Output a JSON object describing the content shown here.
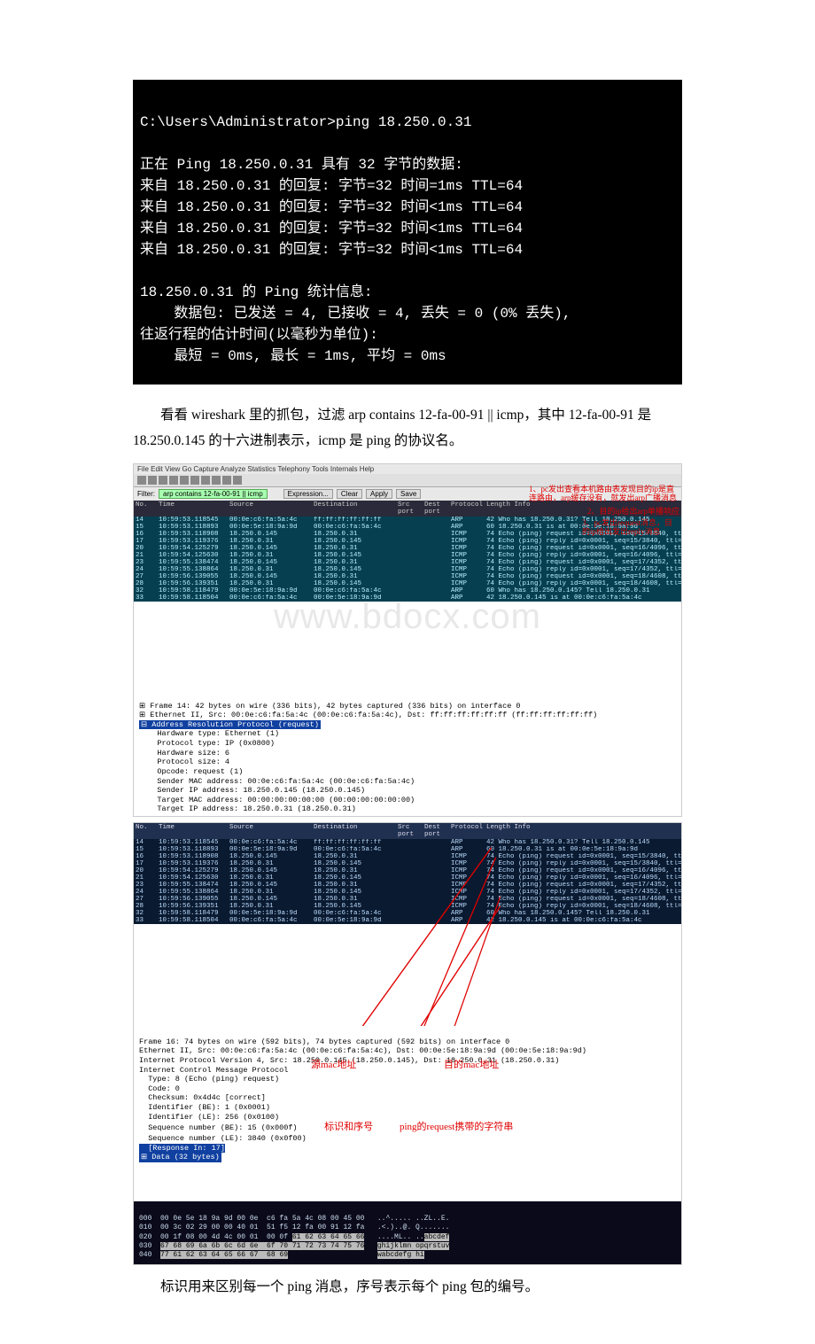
{
  "terminal": {
    "prompt": "C:\\Users\\Administrator>ping 18.250.0.31",
    "l1": "正在 Ping 18.250.0.31 具有 32 字节的数据:",
    "l2": "来自 18.250.0.31 的回复: 字节=32 时间=1ms TTL=64",
    "l3": "来自 18.250.0.31 的回复: 字节=32 时间<1ms TTL=64",
    "l4": "来自 18.250.0.31 的回复: 字节=32 时间<1ms TTL=64",
    "l5": "来自 18.250.0.31 的回复: 字节=32 时间<1ms TTL=64",
    "s1": "18.250.0.31 的 Ping 统计信息:",
    "s2": "    数据包: 已发送 = 4, 已接收 = 4, 丢失 = 0 (0% 丢失),",
    "s3": "往返行程的估计时间(以毫秒为单位):",
    "s4": "    最短 = 0ms, 最长 = 1ms, 平均 = 0ms"
  },
  "para1": "看看 wireshark 里的抓包，过滤 arp contains 12-fa-00-91 || icmp，其中 12-fa-00-91 是 18.250.0.145 的十六进制表示，icmp 是 ping 的协议名。",
  "watermark": "www.bdocx.com",
  "ws": {
    "menubar": "File  Edit  View  Go  Capture  Analyze  Statistics  Telephony  Tools  Internals  Help",
    "filter_label": "Filter:",
    "filter_value": "arp contains 12-fa-00-91 || icmp",
    "btn_expression": "Expression...",
    "btn_clear": "Clear",
    "btn_apply": "Apply",
    "btn_save": "Save",
    "cols": [
      "No.",
      "Time",
      "Source",
      "Destination",
      "Src port",
      "Dest port",
      "Protocol",
      "Length Info"
    ],
    "rows1": [
      {
        "no": "14",
        "time": "10:59:53.118545",
        "src": "00:0e:c6:fa:5a:4c",
        "dst": "ff:ff:ff:ff:ff:ff",
        "p": "ARP",
        "info": "42 Who has 18.250.0.31?  Tell 18.250.0.145"
      },
      {
        "no": "15",
        "time": "10:59:53.118893",
        "src": "00:0e:5e:18:9a:9d",
        "dst": "00:0e:c6:fa:5a:4c",
        "p": "ARP",
        "info": "60 18.250.0.31 is at 00:0e:5e:18:9a:9d"
      },
      {
        "no": "16",
        "time": "10:59:53.118908",
        "src": "18.250.0.145",
        "dst": "18.250.0.31",
        "p": "ICMP",
        "info": "74 Echo (ping) request  id=0x0001, seq=15/3840, ttl=64"
      },
      {
        "no": "17",
        "time": "10:59:53.119376",
        "src": "18.250.0.31",
        "dst": "18.250.0.145",
        "p": "ICMP",
        "info": "74 Echo (ping) reply    id=0x0001, seq=15/3840, ttl=64"
      },
      {
        "no": "20",
        "time": "10:59:54.125279",
        "src": "18.250.0.145",
        "dst": "18.250.0.31",
        "p": "ICMP",
        "info": "74 Echo (ping) request  id=0x0001, seq=16/4096, ttl=64"
      },
      {
        "no": "21",
        "time": "10:59:54.125630",
        "src": "18.250.0.31",
        "dst": "18.250.0.145",
        "p": "ICMP",
        "info": "74 Echo (ping) reply    id=0x0001, seq=16/4096, ttl=64"
      },
      {
        "no": "23",
        "time": "10:59:55.138474",
        "src": "18.250.0.145",
        "dst": "18.250.0.31",
        "p": "ICMP",
        "info": "74 Echo (ping) request  id=0x0001, seq=17/4352, ttl=64"
      },
      {
        "no": "24",
        "time": "10:59:55.138864",
        "src": "18.250.0.31",
        "dst": "18.250.0.145",
        "p": "ICMP",
        "info": "74 Echo (ping) reply    id=0x0001, seq=17/4352, ttl=64"
      },
      {
        "no": "27",
        "time": "10:59:56.139055",
        "src": "18.250.0.145",
        "dst": "18.250.0.31",
        "p": "ICMP",
        "info": "74 Echo (ping) request  id=0x0001, seq=18/4608, ttl=64"
      },
      {
        "no": "28",
        "time": "10:59:56.139351",
        "src": "18.250.0.31",
        "dst": "18.250.0.145",
        "p": "ICMP",
        "info": "74 Echo (ping) reply    id=0x0001, seq=18/4608, ttl=64"
      },
      {
        "no": "32",
        "time": "10:59:58.118479",
        "src": "00:0e:5e:18:9a:9d",
        "dst": "00:0e:c6:fa:5a:4c",
        "p": "ARP",
        "info": "60 Who has 18.250.0.145?  Tell 18.250.0.31"
      },
      {
        "no": "33",
        "time": "10:59:58.118504",
        "src": "00:0e:c6:fa:5a:4c",
        "dst": "00:0e:5e:18:9a:9d",
        "p": "ARP",
        "info": "42 18.250.0.145 is at 00:0e:c6:fa:5a:4c"
      }
    ],
    "anno1": "1、pc发出查看本机路由表发现目的ip是直连路由，arp缓存没有，就发出arp广播消息",
    "anno2": "2、目的ip给出arp单播响应",
    "anno3": "3、pc发出request消息，目的ip给出发出reply消息",
    "details1_l1": "⊞ Frame 14: 42 bytes on wire (336 bits), 42 bytes captured (336 bits) on interface 0",
    "details1_l2": "⊞ Ethernet II, Src: 00:0e:c6:fa:5a:4c (00:0e:c6:fa:5a:4c), Dst: ff:ff:ff:ff:ff:ff (ff:ff:ff:ff:ff:ff)",
    "details1_l3": "⊟ Address Resolution Protocol (request)",
    "details1_l4": "    Hardware type: Ethernet (1)",
    "details1_l5": "    Protocol type: IP (0x0800)",
    "details1_l6": "    Hardware size: 6",
    "details1_l7": "    Protocol size: 4",
    "details1_l8": "    Opcode: request (1)",
    "details1_l9": "    Sender MAC address: 00:0e:c6:fa:5a:4c (00:0e:c6:fa:5a:4c)",
    "details1_l10": "    Sender IP address: 18.250.0.145 (18.250.0.145)",
    "details1_l11": "    Target MAC address: 00:00:00:00:00:00 (00:00:00:00:00:00)",
    "details1_l12": "    Target IP address: 18.250.0.31 (18.250.0.31)"
  },
  "ws2": {
    "rows": [
      {
        "no": "14",
        "time": "10:59:53.118545",
        "src": "00:0e:c6:fa:5a:4c",
        "dst": "ff:ff:ff:ff:ff:ff",
        "p": "ARP",
        "info": "42 Who has 18.250.0.31?  Tell 18.250.0.145"
      },
      {
        "no": "15",
        "time": "10:59:53.118893",
        "src": "00:0e:5e:18:9a:9d",
        "dst": "00:0e:c6:fa:5a:4c",
        "p": "ARP",
        "info": "60 18.250.0.31 is at 00:0e:5e:18:9a:9d"
      },
      {
        "no": "16",
        "time": "10:59:53.118908",
        "src": "18.250.0.145",
        "dst": "18.250.0.31",
        "p": "ICMP",
        "info": "74 Echo (ping) request  id=0x0001, seq=15/3840, ttl=64"
      },
      {
        "no": "17",
        "time": "10:59:53.119376",
        "src": "18.250.0.31",
        "dst": "18.250.0.145",
        "p": "ICMP",
        "info": "74 Echo (ping) reply    id=0x0001, seq=15/3840, ttl=64"
      },
      {
        "no": "20",
        "time": "10:59:54.125279",
        "src": "18.250.0.145",
        "dst": "18.250.0.31",
        "p": "ICMP",
        "info": "74 Echo (ping) request  id=0x0001, seq=16/4096, ttl=64"
      },
      {
        "no": "21",
        "time": "10:59:54.125630",
        "src": "18.250.0.31",
        "dst": "18.250.0.145",
        "p": "ICMP",
        "info": "74 Echo (ping) reply    id=0x0001, seq=16/4096, ttl=64"
      },
      {
        "no": "23",
        "time": "10:59:55.138474",
        "src": "18.250.0.145",
        "dst": "18.250.0.31",
        "p": "ICMP",
        "info": "74 Echo (ping) request  id=0x0001, seq=17/4352, ttl=64"
      },
      {
        "no": "24",
        "time": "10:59:55.138864",
        "src": "18.250.0.31",
        "dst": "18.250.0.145",
        "p": "ICMP",
        "info": "74 Echo (ping) reply    id=0x0001, seq=17/4352, ttl=64"
      },
      {
        "no": "27",
        "time": "10:59:56.139055",
        "src": "18.250.0.145",
        "dst": "18.250.0.31",
        "p": "ICMP",
        "info": "74 Echo (ping) request  id=0x0001, seq=18/4608, ttl=64"
      },
      {
        "no": "28",
        "time": "10:59:56.139351",
        "src": "18.250.0.31",
        "dst": "18.250.0.145",
        "p": "ICMP",
        "info": "74 Echo (ping) reply    id=0x0001, seq=18/4608, ttl=64"
      },
      {
        "no": "32",
        "time": "10:59:58.118479",
        "src": "00:0e:5e:18:9a:9d",
        "dst": "00:0e:c6:fa:5a:4c",
        "p": "ARP",
        "info": "60 Who has 18.250.0.145?  Tell 18.250.0.31"
      },
      {
        "no": "33",
        "time": "10:59:58.118504",
        "src": "00:0e:c6:fa:5a:4c",
        "dst": "00:0e:5e:18:9a:9d",
        "p": "ARP",
        "info": "42 18.250.0.145 is at 00:0e:c6:fa:5a:4c"
      }
    ],
    "details_l1": "Frame 16: 74 bytes on wire (592 bits), 74 bytes captured (592 bits) on interface 0",
    "details_l2": "Ethernet II, Src: 00:0e:c6:fa:5a:4c (00:0e:c6:fa:5a:4c), Dst: 00:0e:5e:18:9a:9d (00:0e:5e:18:9a:9d)",
    "details_l3": "Internet Protocol Version 4, Src: 18.250.0.145 (18.250.0.145), Dst: 18.250.0.31 (18.250.0.31)",
    "details_l4": "Internet Control Message Protocol",
    "details_l5": "  Type: 8 (Echo (ping) request)",
    "details_l6": "  Code: 0",
    "details_l7": "  Checksum: 0x4d4c [correct]",
    "details_l8": "  Identifier (BE): 1 (0x0001)",
    "details_l9": "  Identifier (LE): 256 (0x0100)",
    "details_l10": "  Sequence number (BE): 15 (0x000f)",
    "details_l11": "  Sequence number (LE): 3840 (0x0f00)",
    "details_l12": "  [Response In: 17]",
    "details_l13": "⊞ Data (32 bytes)",
    "lbl_srcmac": "源mac地址",
    "lbl_dstmac": "目的mac地址",
    "lbl_idseq": "标识和序号",
    "lbl_reqstr": "ping的request携带的字符串"
  },
  "hex": {
    "r0": "000  00 0e 5e 18 9a 9d 00 0e  c6 fa 5a 4c 08 00 45 00   ..^..... ..ZL..E.",
    "r1": "010  00 3c 02 29 00 00 40 01  51 f5 12 fa 00 91 12 fa   .<.)..@. Q.......",
    "r2": "020  00 1f 08 00 4d 4c 00 01  00 0f 61 62 63 64 65 66   ....ML.. ..abcdef",
    "r3": "030  67 68 69 6a 6b 6c 6d 6e  6f 70 71 72 73 74 75 76   ghijklmn opqrstuv",
    "r4": "040  77 61 62 63 64 65 66 67  68 69                     wabcdefg hi"
  },
  "para2": "标识用来区别每一个 ping 消息，序号表示每个 ping 包的编号。"
}
